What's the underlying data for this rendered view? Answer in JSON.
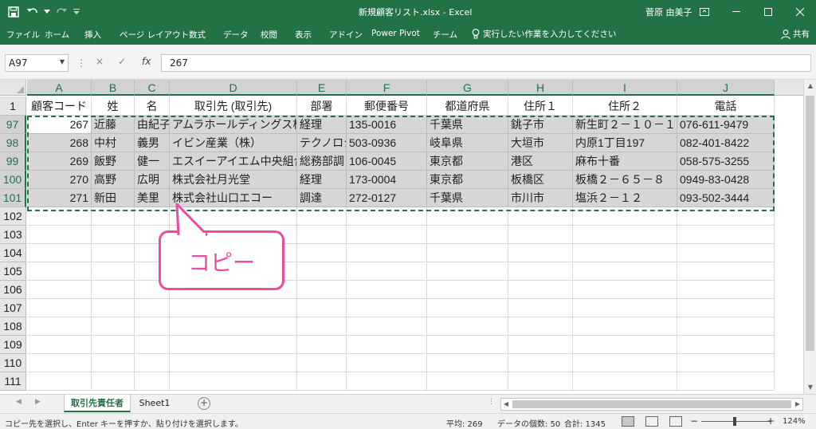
{
  "titlebar": {
    "title": "新規顧客リスト.xlsx  -  Excel",
    "user": "菅原 由美子",
    "save_icon": "save-icon",
    "undo_icon": "undo-icon",
    "redo_icon": "redo-icon",
    "customize_icon": "customize-qat-icon"
  },
  "ribbon": {
    "tabs": [
      "ファイル",
      "ホーム",
      "挿入",
      "ページ レイアウト",
      "数式",
      "データ",
      "校閲",
      "表示",
      "アドイン",
      "Power Pivot",
      "チーム"
    ],
    "tell_me": "実行したい作業を入力してください",
    "share": "共有"
  },
  "formula_bar": {
    "name_box": "A97",
    "cancel": "×",
    "enter": "✓",
    "fx": "fx",
    "value": "267"
  },
  "grid": {
    "columns": [
      "A",
      "B",
      "C",
      "D",
      "E",
      "F",
      "G",
      "H",
      "I",
      "J"
    ],
    "header_row": {
      "row_num": "1",
      "cells": [
        "顧客コード",
        "姓",
        "名",
        "取引先 (取引先)",
        "部署",
        "郵便番号",
        "都道府県",
        "住所１",
        "住所２",
        "電話"
      ]
    },
    "data_rows": [
      {
        "row_num": "97",
        "cells": [
          "267",
          "近藤",
          "由紀子",
          "アムラホールディングス株式会社",
          "経理",
          "135-0016",
          "千葉県",
          "銚子市",
          "新生町２－１０－１",
          "076-611-9479"
        ]
      },
      {
        "row_num": "98",
        "cells": [
          "268",
          "中村",
          "義男",
          "イビン産業（株）",
          "テクノロジー",
          "503-0936",
          "岐阜県",
          "大垣市",
          "内原1丁目197",
          "082-401-8422"
        ]
      },
      {
        "row_num": "99",
        "cells": [
          "269",
          "飯野",
          "健一",
          "エスイーアイエム中央組合",
          "総務部調",
          "106-0045",
          "東京都",
          "港区",
          "麻布十番",
          "058-575-3255"
        ]
      },
      {
        "row_num": "100",
        "cells": [
          "270",
          "高野",
          "広明",
          "株式会社月光堂",
          "経理",
          "173-0004",
          "東京都",
          "板橋区",
          "板橋２－６５－８",
          "0949-83-0428"
        ]
      },
      {
        "row_num": "101",
        "cells": [
          "271",
          "新田",
          "美里",
          "株式会社山口エコー",
          "調達",
          "272-0127",
          "千葉県",
          "市川市",
          "塩浜２－１２",
          "093-502-3444"
        ]
      }
    ],
    "empty_rows": [
      "102",
      "103",
      "104",
      "105",
      "106",
      "107",
      "108",
      "109",
      "110",
      "111"
    ]
  },
  "callout": {
    "text": "コピー",
    "color": "#ee4b9f"
  },
  "sheets": {
    "tabs": [
      "取引先責任者",
      "Sheet1"
    ],
    "active": "取引先責任者",
    "add": "+"
  },
  "status": {
    "message": "コピー先を選択し、Enter キーを押すか、貼り付けを選択します。",
    "average": "平均: 269",
    "count": "データの個数: 50",
    "sum": "合計: 1345",
    "zoom_minus": "−",
    "zoom_plus": "+",
    "zoom": "124%"
  },
  "colors": {
    "accent": "#217346",
    "selection": "#d6d6d6"
  }
}
